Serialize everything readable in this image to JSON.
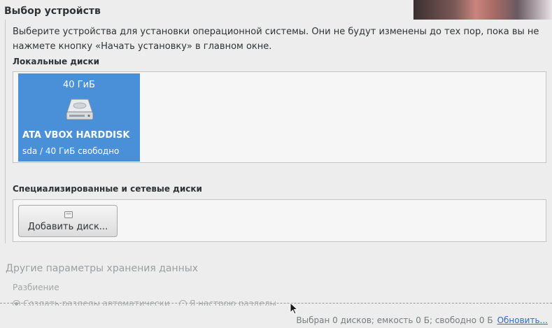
{
  "header": {
    "title": "Выбор устройств"
  },
  "description": "Выберите устройства для установки операционной системы. Они не будут изменены до тех пор, пока вы не нажмете кнопку «Начать установку» в главном окне.",
  "local_disks": {
    "heading": "Локальные диски",
    "disks": [
      {
        "size": "40 ГиБ",
        "name": "ATA VBOX HARDDISK",
        "details": "sda / 40 ГиБ свободно",
        "icon": "harddisk-icon",
        "selected": true
      }
    ]
  },
  "special_disks": {
    "heading": "Специализированные и сетевые диски",
    "add_button_label": "Добавить диск...",
    "add_button_icon": "add-disk-icon"
  },
  "other_storage": {
    "heading": "Другие параметры хранения данных",
    "partitioning_label": "Разбиение",
    "options": [
      {
        "label": "Создать разделы автоматически",
        "checked": true
      },
      {
        "label": "Я настрою разделы",
        "checked": false
      }
    ]
  },
  "footer": {
    "summary": "Выбран 0 дисков; емкость 0 Б; свободно 0 Б",
    "refresh_label": "Обновить..."
  },
  "colors": {
    "background": "#ededed",
    "selected_tile": "#4a90d9",
    "link": "#2a6fc9",
    "disabled_text": "#9aa0a2"
  }
}
